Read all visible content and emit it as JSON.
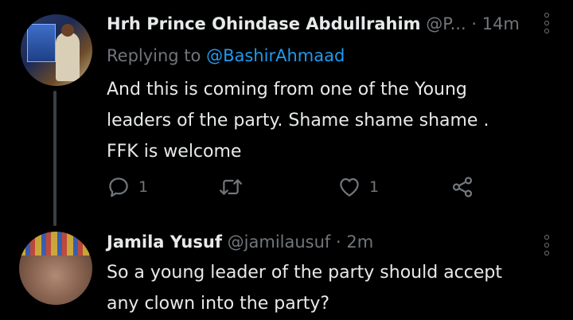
{
  "tweets": [
    {
      "display_name": "Hrh Prince Ohindase Abdullrahim",
      "handle": "@P...",
      "separator": "·",
      "time": "14m",
      "replying_prefix": "Replying to ",
      "replying_to": "@BashirAhmaad",
      "text": "And this is coming from one of the Young\nleaders of the party. Shame shame shame .\nFFK is welcome",
      "reply_count": "1",
      "retweet_count": "",
      "like_count": "1"
    },
    {
      "display_name": "Jamila Yusuf",
      "handle": "@jamilausuf",
      "separator": "·",
      "time": "2m",
      "text": "So a young leader of the party should accept\nany clown into the party?"
    }
  ],
  "icons": {
    "reply": "reply-icon",
    "retweet": "retweet-icon",
    "like": "heart-icon",
    "share": "share-icon",
    "more": "more-vertical-icon"
  },
  "colors": {
    "background": "#000000",
    "text": "#e7e9ea",
    "secondary": "#71767b",
    "link": "#1d9bf0"
  }
}
